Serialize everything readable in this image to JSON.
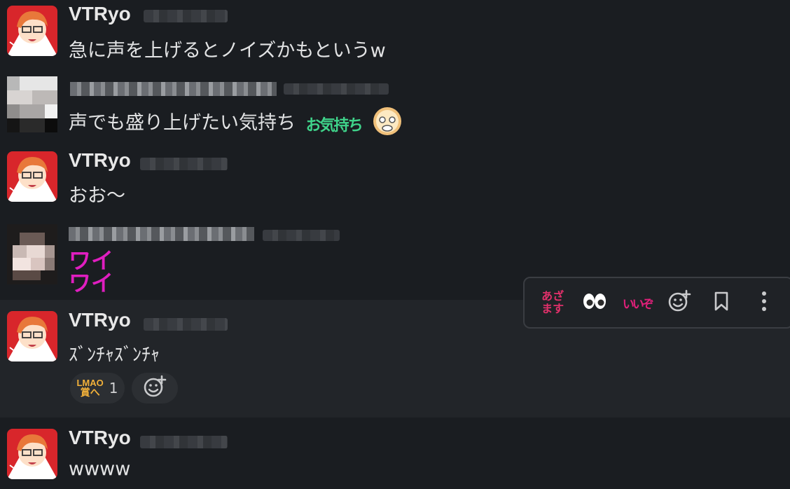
{
  "messages": [
    {
      "author": "VTRyo",
      "text": "急に声を上げるとノイズかもというw"
    },
    {
      "author": "",
      "text": "声でも盛り上げたい気持ち",
      "emoji_text": "お気持ち"
    },
    {
      "author": "VTRyo",
      "text": "おお〜"
    },
    {
      "author": "",
      "lines": [
        "ワイ",
        "ワイ"
      ]
    },
    {
      "author": "VTRyo",
      "text": "ｽﾞﾝﾁｬｽﾞﾝﾁｬ",
      "reaction": {
        "emoji_text": [
          "LMAO",
          "賞へ"
        ],
        "count": "1"
      }
    },
    {
      "author": "VTRyo",
      "text": "wwww"
    }
  ],
  "toolbar": {
    "azamasu_lines": [
      "あざ",
      "ます"
    ],
    "iine": "いいぞ",
    "eyes_icon": "eyes-icon",
    "add_reaction_icon": "add-reaction-icon",
    "bookmark_icon": "bookmark-icon",
    "more_icon": "more-vertical-icon"
  },
  "colors": {
    "background": "#1a1d21",
    "hover_background": "#222529",
    "pink_text": "#e01ec0",
    "azamasu": "#e0306a",
    "iine": "#e0207a",
    "okimochi": "#3fd38a",
    "lmao": "#f2b13a"
  }
}
